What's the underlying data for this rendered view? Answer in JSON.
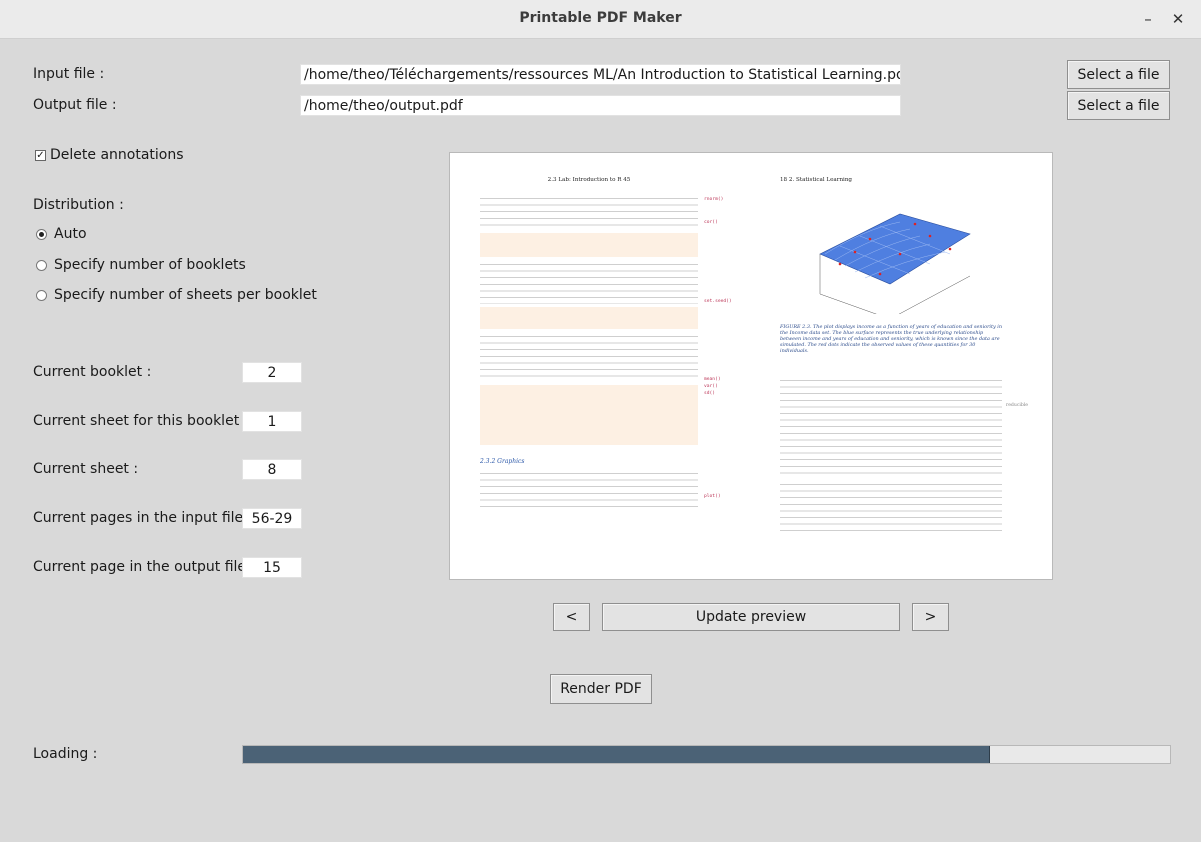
{
  "window": {
    "title": "Printable PDF Maker"
  },
  "files": {
    "input_label": "Input file :",
    "input_value": "/home/theo/Téléchargements/ressources ML/An Introduction to Statistical Learning.pdf",
    "output_label": "Output file :",
    "output_value": "/home/theo/output.pdf",
    "select_label": "Select a file"
  },
  "options": {
    "delete_annotations_label": "Delete annotations",
    "delete_annotations_checked": true,
    "distribution_label": "Distribution :",
    "radios": [
      {
        "label": "Auto",
        "selected": true
      },
      {
        "label": "Specify number of booklets",
        "selected": false
      },
      {
        "label": "Specify number of sheets per booklet",
        "selected": false
      }
    ]
  },
  "status": [
    {
      "label": "Current booklet :",
      "value": "2"
    },
    {
      "label": "Current sheet for this booklet :",
      "value": "1"
    },
    {
      "label": "Current sheet :",
      "value": "8"
    },
    {
      "label": "Current pages in the input file :",
      "value": "56-29"
    },
    {
      "label": "Current page in the output file :",
      "value": "15"
    }
  ],
  "preview": {
    "left_header": "2.3 Lab: Introduction to R      45",
    "right_header": "18     2. Statistical Learning",
    "section": "2.3.2   Graphics",
    "figure_caption": "FIGURE 2.3. The plot displays income as a function of years of education and seniority in the Income data set. The blue surface represents the true underlying relationship between income and years of education and seniority, which is known since the data are simulated. The red dots indicate the observed values of these quantities for 30 individuals."
  },
  "nav": {
    "prev_label": "<",
    "update_label": "Update preview",
    "next_label": ">"
  },
  "render_label": "Render PDF",
  "loading": {
    "label": "Loading :",
    "progress": 0.806
  }
}
